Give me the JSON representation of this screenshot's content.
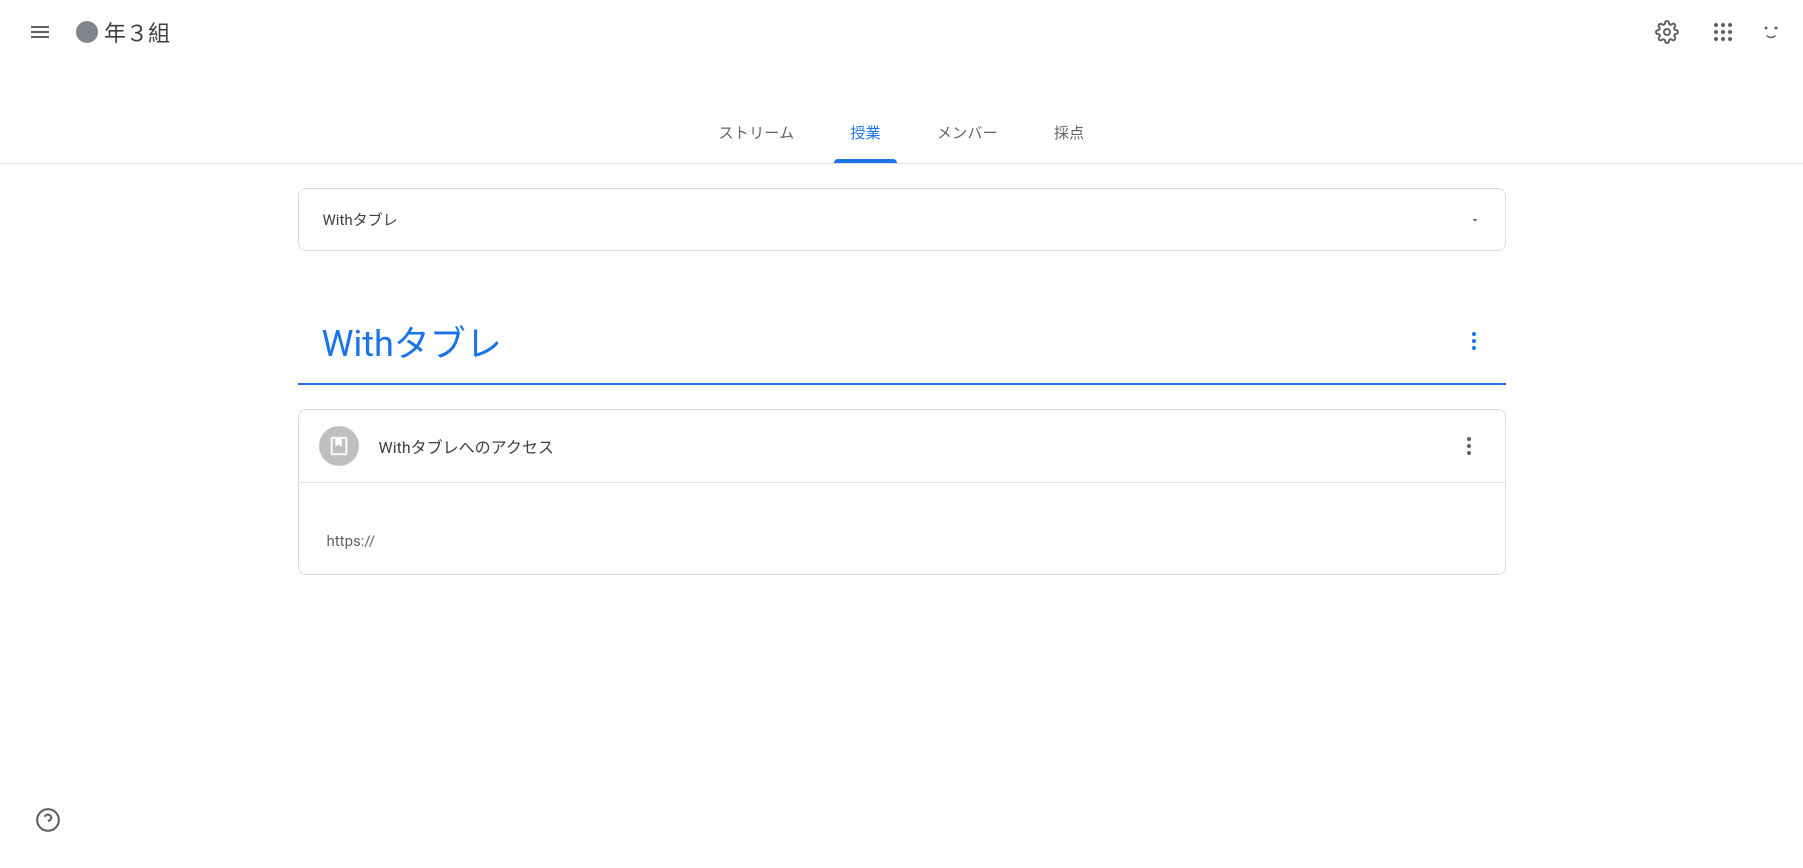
{
  "header": {
    "class_title": "年３組"
  },
  "tabs": {
    "stream": "ストリーム",
    "classwork": "授業",
    "people": "メンバー",
    "grades": "採点"
  },
  "topic_select": {
    "label": "Withタブレ"
  },
  "topic": {
    "title": "Withタブレ"
  },
  "material": {
    "title": "Withタブレへのアクセス",
    "body": "https://"
  }
}
